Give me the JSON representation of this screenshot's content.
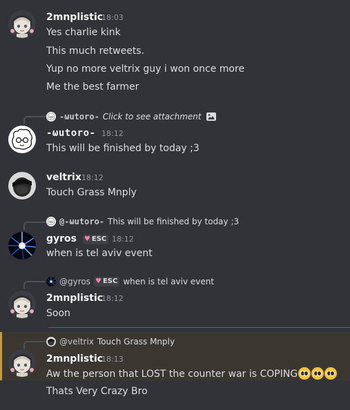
{
  "messages": [
    {
      "author": "2mnplistic",
      "time": "18:03",
      "lines": [
        "Yes charlie kink",
        "This much retweets.",
        "Yup no more veltrix guy i won once more",
        "Me the best farmer"
      ]
    },
    {
      "reply": {
        "author": "-ωutoro-",
        "text": "Click to see attachment",
        "icon": "image-icon"
      },
      "author": "-ωutoro-",
      "time": "18:12",
      "lines": [
        "This will be finished by today ;3"
      ]
    },
    {
      "author": "veltrix",
      "time": "18:12",
      "lines": [
        "Touch Grass Mnply"
      ]
    },
    {
      "reply": {
        "author": "@-ωutoro-",
        "text": "This will be finished by today ;3"
      },
      "author": "gyros",
      "badge": "ESC",
      "time": "18:12",
      "lines": [
        "when is tel aviv event"
      ]
    },
    {
      "reply": {
        "author": "@gyros",
        "badge": "ESC",
        "text": "when is tel aviv event"
      },
      "author": "2mnplistic",
      "time": "18:12",
      "lines": [
        "Soon"
      ]
    },
    {
      "reply": {
        "author": "@veltrix",
        "text": "Touch Grass Mnply"
      },
      "author": "2mnplistic",
      "time": "18:13",
      "lines": [
        "Aw the person that LOST the counter war is COPING",
        "Thats Very Crazy Bro"
      ],
      "emoji": "pleading-face-emoji",
      "highlighted": true
    }
  ],
  "colors": {
    "background": "#313338",
    "highlight": "#3a3630",
    "highlight_bar": "#c49b3f",
    "divider": "#b3443a",
    "text": "#dbdee1",
    "username": "#f2f3f5",
    "timestamp": "#949ba4"
  }
}
